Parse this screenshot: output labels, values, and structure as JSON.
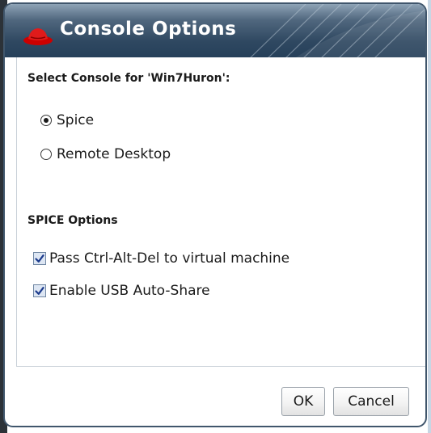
{
  "dialog": {
    "title": "Console Options",
    "logo_icon": "redhat-shadowman-icon"
  },
  "console_select": {
    "heading": "Select Console for 'Win7Huron':",
    "options": [
      {
        "label": "Spice",
        "selected": true
      },
      {
        "label": "Remote Desktop",
        "selected": false
      }
    ]
  },
  "spice_options": {
    "heading": "SPICE Options",
    "checkboxes": [
      {
        "label": "Pass Ctrl-Alt-Del to virtual machine",
        "checked": true
      },
      {
        "label": "Enable USB Auto-Share",
        "checked": true
      }
    ]
  },
  "footer": {
    "ok_label": "OK",
    "cancel_label": "Cancel"
  },
  "colors": {
    "titlebar": "#2f4861",
    "logo_red": "#cc0000",
    "checkbox_fill": "#dde6f3",
    "check_mark": "#1b3a8c"
  }
}
